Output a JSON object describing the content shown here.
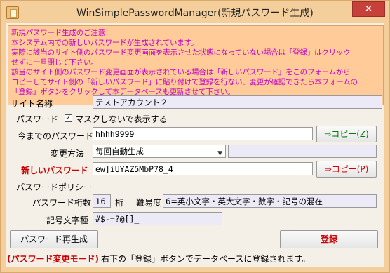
{
  "window": {
    "title": "WinSimplePasswordManager(新規パスワード生成)"
  },
  "notice": {
    "lines": [
      "新規パスワード生成のご注意！",
      "本システム内での新しいパスワードが生成されています。",
      "実際に該当のサイト側のパスワード変更画面を表示させた状態になっていない場合は「登録」はクリック",
      "せずに一旦閉じて下さい。",
      "該当のサイト側のパスワード変更画面が表示されている場合は「新しいパスワード」をこのフォームから",
      "コピーしてサイト側の「新しいパスワード」に貼り付けて登録を行ない、変更が確認できたら本フォームの",
      "「登録」ボタンをクリックして本データベースも更新させて下さい。"
    ]
  },
  "site": {
    "label": "サイト名称",
    "value": "テストアカウント２"
  },
  "password_group": {
    "title": "パスワード",
    "mask_label": "マスクしないで表示する",
    "mask_checked": true
  },
  "old_password": {
    "label": "今までのパスワード",
    "value": "hhhh9999",
    "copy_button": "⇒コピー(Z)"
  },
  "change_method": {
    "label": "変更方法",
    "selected": "毎回自動生成",
    "extra_value": ""
  },
  "new_password": {
    "label": "新しいパスワード",
    "value": "ew]iUYAZ5MbP78_4",
    "copy_button": "⇒コピー(P)"
  },
  "policy": {
    "title": "パスワードポリシー",
    "digits_label": "パスワード桁数",
    "digits_value": "16",
    "digits_unit": "桁",
    "difficulty_label": "難易度",
    "difficulty_value": "6=英小文字・英大文字・数字・記号の混在",
    "symbols_label": "記号文字種",
    "symbols_value": "#$-=?@[]_"
  },
  "buttons": {
    "regenerate": "パスワード再生成",
    "register": "登録"
  },
  "status": {
    "mode": "(パスワード変更モード)",
    "message": "右下の「登録」ボタンでデータベースに登録されます。"
  },
  "colors": {
    "accent_red": "#cc0000",
    "notice_text": "#c400c4",
    "green_button_text": "#007a00",
    "red_button_text": "#cc0000"
  },
  "icons": {
    "close": "close-icon",
    "app": "app-icon",
    "check": "checkmark-icon",
    "dropdown": "chevron-down-icon"
  }
}
